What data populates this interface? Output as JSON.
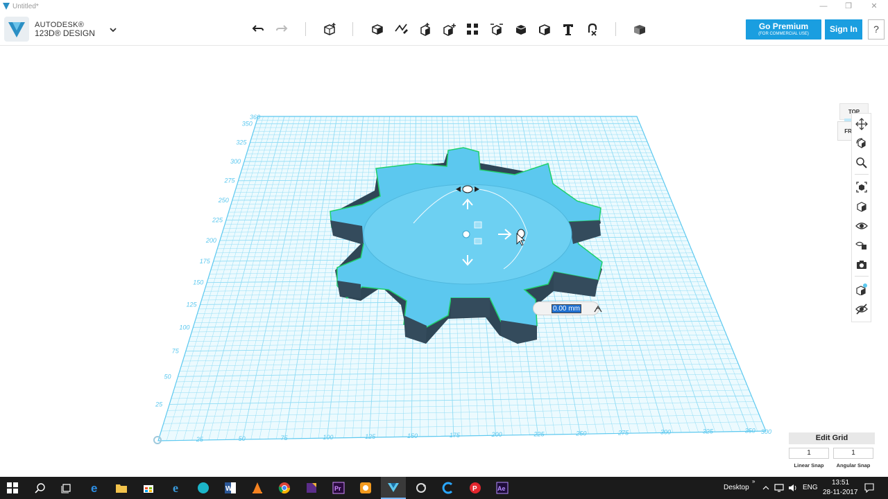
{
  "window": {
    "title": "Untitled*",
    "minimize": "—",
    "restore": "❐",
    "close": "✕"
  },
  "brand": {
    "line1": "AUTODESK®",
    "line2": "123D® DESIGN"
  },
  "toolbar": {
    "undo_icon": "undo-icon",
    "redo_icon": "redo-icon",
    "tools": [
      "transform-icon",
      "primitives-icon",
      "sketch-icon",
      "construct-icon",
      "modify-icon",
      "pattern-icon",
      "grouping-icon",
      "combine-icon",
      "measure-icon",
      "text-icon",
      "snap-icon",
      "material-icon"
    ],
    "premium_line1": "Go Premium",
    "premium_line2": "(FOR COMMERCIAL USE)",
    "signin": "Sign In",
    "help": "?"
  },
  "viewcube": {
    "top": "TOP",
    "front": "FRONT"
  },
  "grid": {
    "y_ticks": [
      "350",
      "325",
      "300",
      "275",
      "250",
      "225",
      "200",
      "175",
      "150",
      "125",
      "100",
      "75",
      "50",
      "25"
    ],
    "y_top_label": "360",
    "x_ticks": [
      "25",
      "50",
      "75",
      "100",
      "125",
      "150",
      "175",
      "200",
      "225",
      "250",
      "275",
      "300",
      "325",
      "350"
    ],
    "x_end_label": "300"
  },
  "value_input": {
    "value": "0.00 mm"
  },
  "edit_grid": {
    "title": "Edit Grid",
    "linear_value": "1",
    "angular_value": "1",
    "linear_label": "Linear Snap",
    "angular_label": "Angular Snap"
  },
  "navbar": {
    "items": [
      "pan-icon",
      "orbit-icon",
      "zoom-icon",
      "fit-icon",
      "view-mode-icon",
      "visibility-icon",
      "material-display-icon",
      "screenshot-icon",
      "grid-snap-icon",
      "hide-icon"
    ]
  },
  "taskbar": {
    "desktop_label": "Desktop",
    "lang": "ENG",
    "time": "13:51",
    "date": "28-11-2017",
    "colors": {
      "accent": "#1a9ee0",
      "gear": "#5cc8ef",
      "grid": "#7fd6f3"
    }
  }
}
